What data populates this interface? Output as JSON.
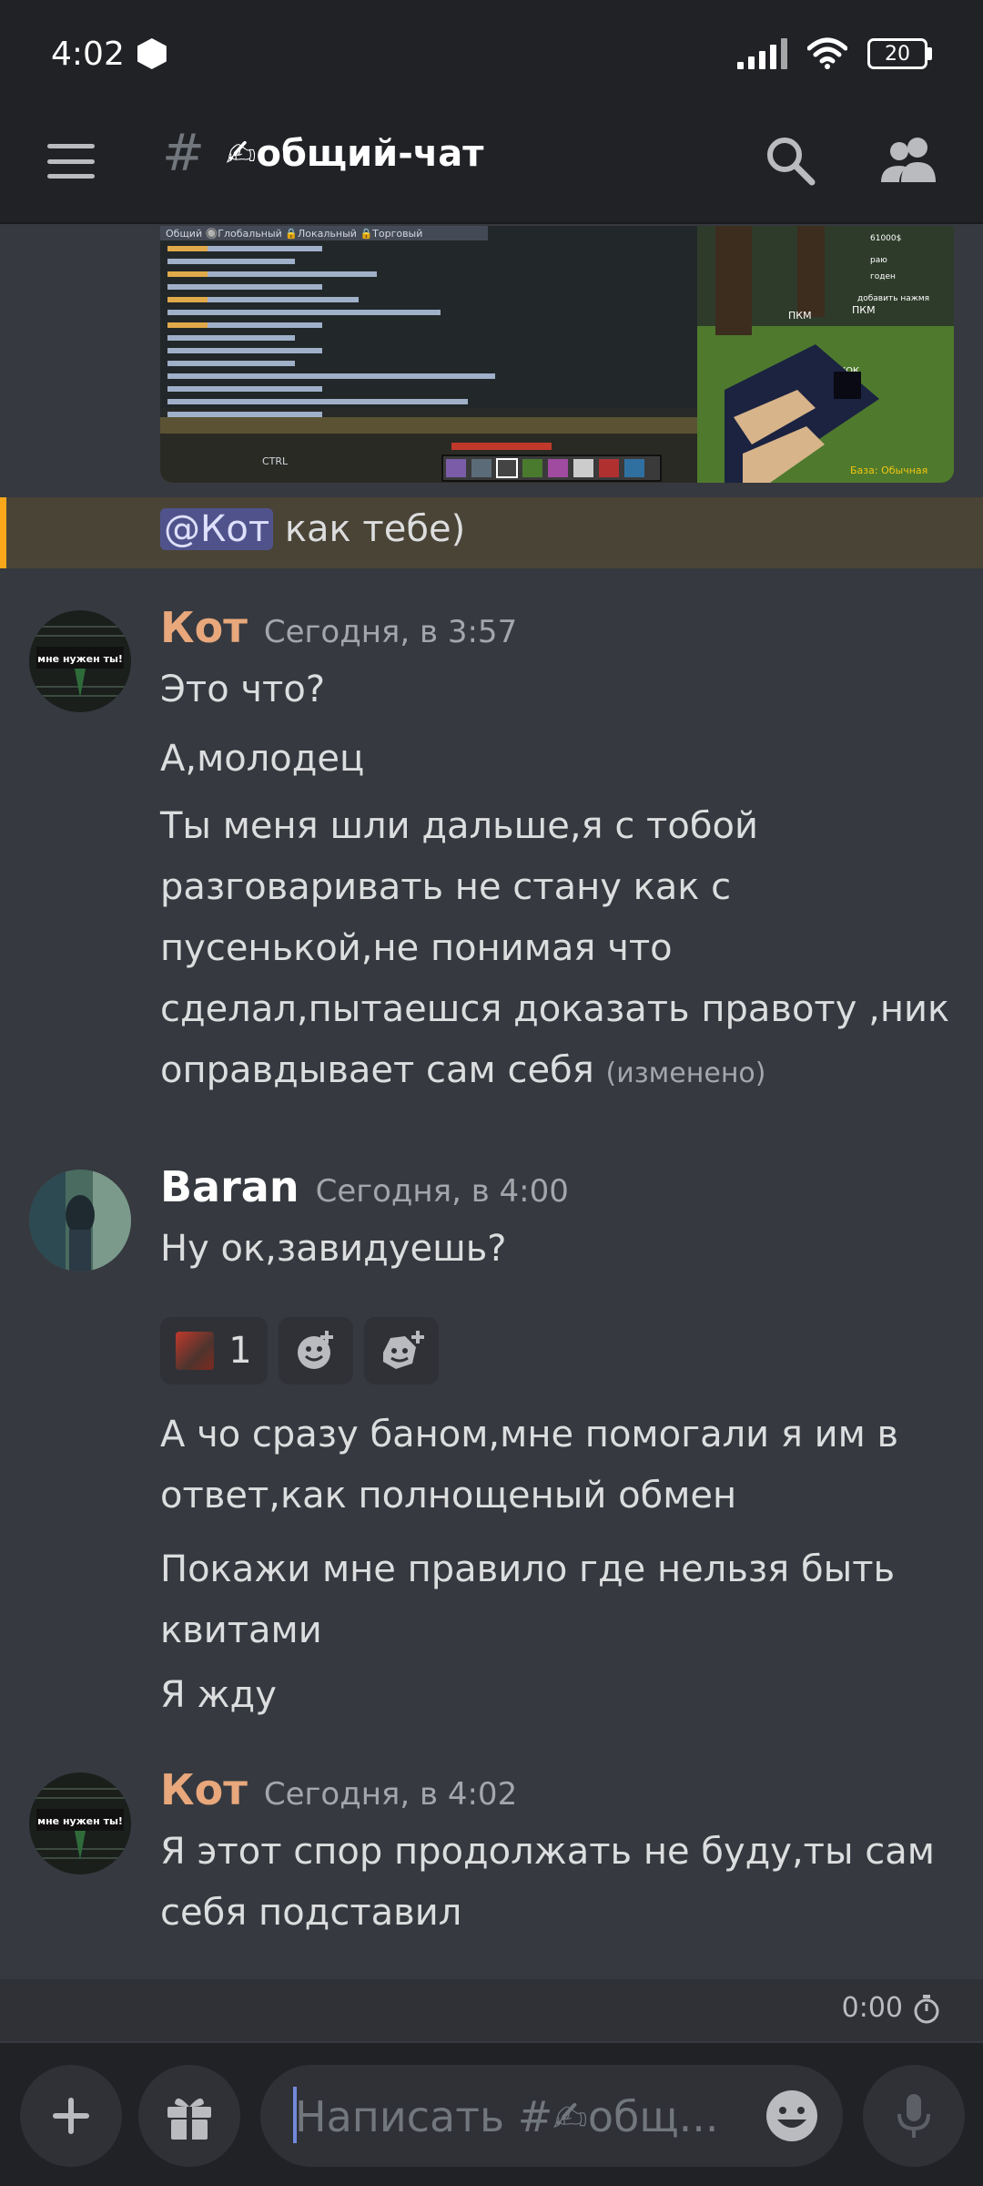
{
  "status_bar": {
    "time": "4:02",
    "battery": "20"
  },
  "header": {
    "menu_icon": "hamburger-icon",
    "hash_symbol": "#",
    "channel_title": "✍общий-чат",
    "search_icon": "search-icon",
    "members_icon": "members-icon"
  },
  "embed": {
    "type": "minecraft-screenshot",
    "chat_tabs": "Общий 🔘Глобальный 🔒Локальный 🔒Торговый",
    "hud_label": "CTRL",
    "side_labels": [
      "ПКМ",
      "ПКМ",
      "ПРЫЖОК"
    ],
    "mode_label": "База: Обычная",
    "right_list": [
      "61000$",
      "раю",
      "добавить нажмя",
      "годен"
    ]
  },
  "mention_message": {
    "mention": "@Кот",
    "text": " как тебе)"
  },
  "messages": [
    {
      "author": "Кот",
      "author_color": "#e8a87c",
      "timestamp": "Сегодня, в 3:57",
      "avatar_text": "мне нужен ты!",
      "lines": [
        "Это что?",
        "А,молодец",
        "Ты меня шли дальше,я с тобой разговаривать не стану как с пусенькой,не понимая что сделал,пытаешся доказать правоту ,ник оправдывает сам себя"
      ],
      "edited_label": "(изменено)"
    },
    {
      "author": "Baran",
      "author_color": "#ffffff",
      "timestamp": "Сегодня, в 4:00",
      "lines": [
        "Ну ок,завидуешь?",
        "А чо сразу баном,мне помогали я им в ответ,как полнощеный обмен",
        "Покажи мне правило где нельзя быть квитами",
        "Я жду"
      ],
      "reactions": [
        {
          "count": "1",
          "icon": "user-reaction-avatar"
        },
        {
          "icon": "add-reaction-icon"
        },
        {
          "icon": "add-super-reaction-icon"
        }
      ]
    },
    {
      "author": "Кот",
      "author_color": "#e8a87c",
      "timestamp": "Сегодня, в 4:02",
      "avatar_text": "мне нужен ты!",
      "lines": [
        "Я этот спор продолжать не буду,ты сам себя подставил"
      ]
    }
  ],
  "timer": {
    "value": "0:00",
    "icon": "stopwatch-icon"
  },
  "composer": {
    "plus_icon": "plus-icon",
    "gift_icon": "gift-icon",
    "placeholder": "Написать #✍общ...",
    "emoji_icon": "emoji-icon",
    "mic_icon": "microphone-icon"
  }
}
